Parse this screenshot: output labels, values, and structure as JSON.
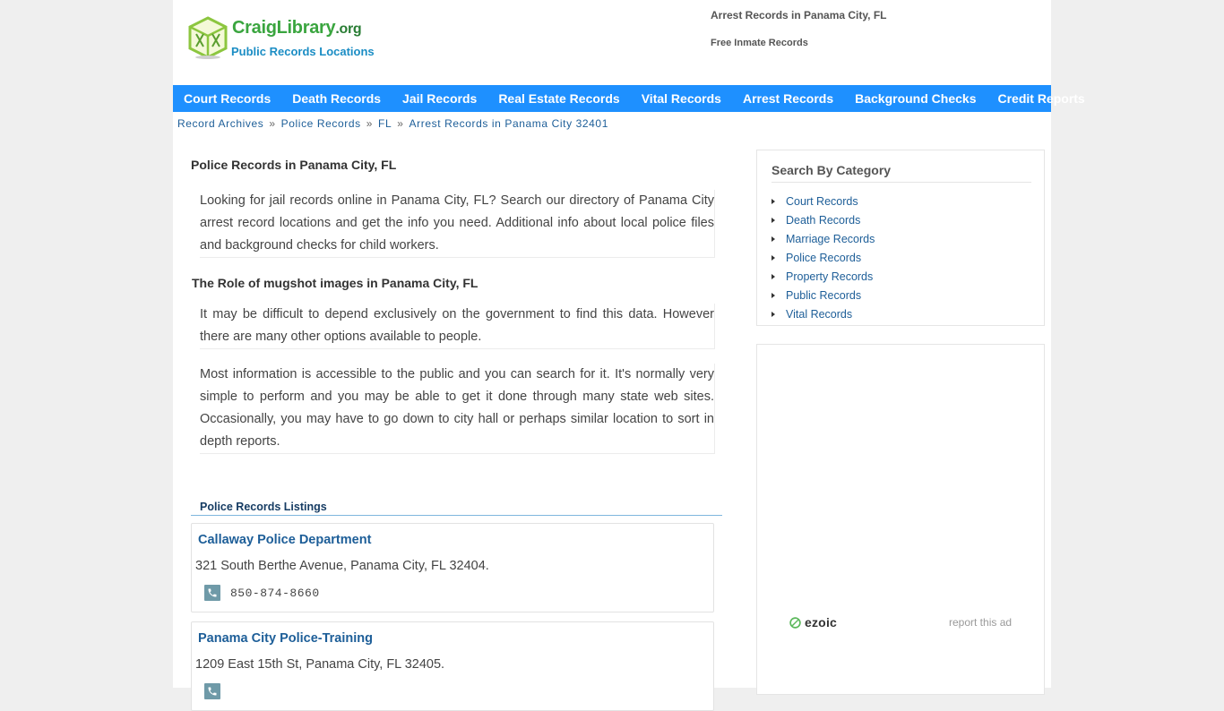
{
  "header": {
    "logo_brand": "CraigLibrary",
    "logo_tld": ".org",
    "logo_tagline": "Public Records Locations",
    "right_title": "Arrest Records in Panama City, FL",
    "right_sub": "Free Inmate Records"
  },
  "nav": {
    "items": [
      {
        "label": "Court Records"
      },
      {
        "label": "Death Records"
      },
      {
        "label": "Jail Records"
      },
      {
        "label": "Real Estate Records"
      },
      {
        "label": "Vital Records"
      },
      {
        "label": "Arrest Records"
      },
      {
        "label": "Background Checks"
      },
      {
        "label": "Credit Reports"
      }
    ]
  },
  "breadcrumb": {
    "items": [
      {
        "label": "Record Archives"
      },
      {
        "label": "Police Records"
      },
      {
        "label": "FL"
      },
      {
        "label": "Arrest Records in Panama City 32401"
      }
    ],
    "separator": "»"
  },
  "main": {
    "title1": "Police Records in Panama City, FL",
    "para1": "Looking for jail records online in Panama City, FL? Search our directory of Panama City arrest record locations and get the info you need. Additional info about local police files and background checks for child workers.",
    "title2": "The Role of mugshot images in Panama City, FL",
    "para2": "It may be difficult to depend exclusively on the government to find this data. However there are many other options available to people.",
    "para3": "Most information is accessible to the public and you can search for it. It's normally very simple to perform and you may be able to get it done through many state web sites. Occasionally, you may have to go down to city hall or perhaps similar location to sort in depth reports.",
    "listings_title": "Police Records Listings",
    "listings": [
      {
        "name": "Callaway Police Department",
        "address": "321 South Berthe Avenue, Panama City, FL 32404.",
        "phone": "850-874-8660"
      },
      {
        "name": "Panama City Police-Training",
        "address": "1209 East 15th St, Panama City, FL 32405.",
        "phone": ""
      }
    ]
  },
  "sidebar": {
    "category_title": "Search By Category",
    "categories": [
      {
        "label": "Court Records"
      },
      {
        "label": "Death Records"
      },
      {
        "label": "Marriage Records"
      },
      {
        "label": "Police Records"
      },
      {
        "label": "Property Records"
      },
      {
        "label": "Public Records"
      },
      {
        "label": "Vital Records"
      }
    ],
    "ad_brand": "ezoic",
    "ad_report": "report this ad"
  },
  "colors": {
    "nav_bg": "#1e90ff",
    "link": "#1d5e98",
    "logo_green": "#3aa53f",
    "logo_blue": "#1b8dc4"
  }
}
